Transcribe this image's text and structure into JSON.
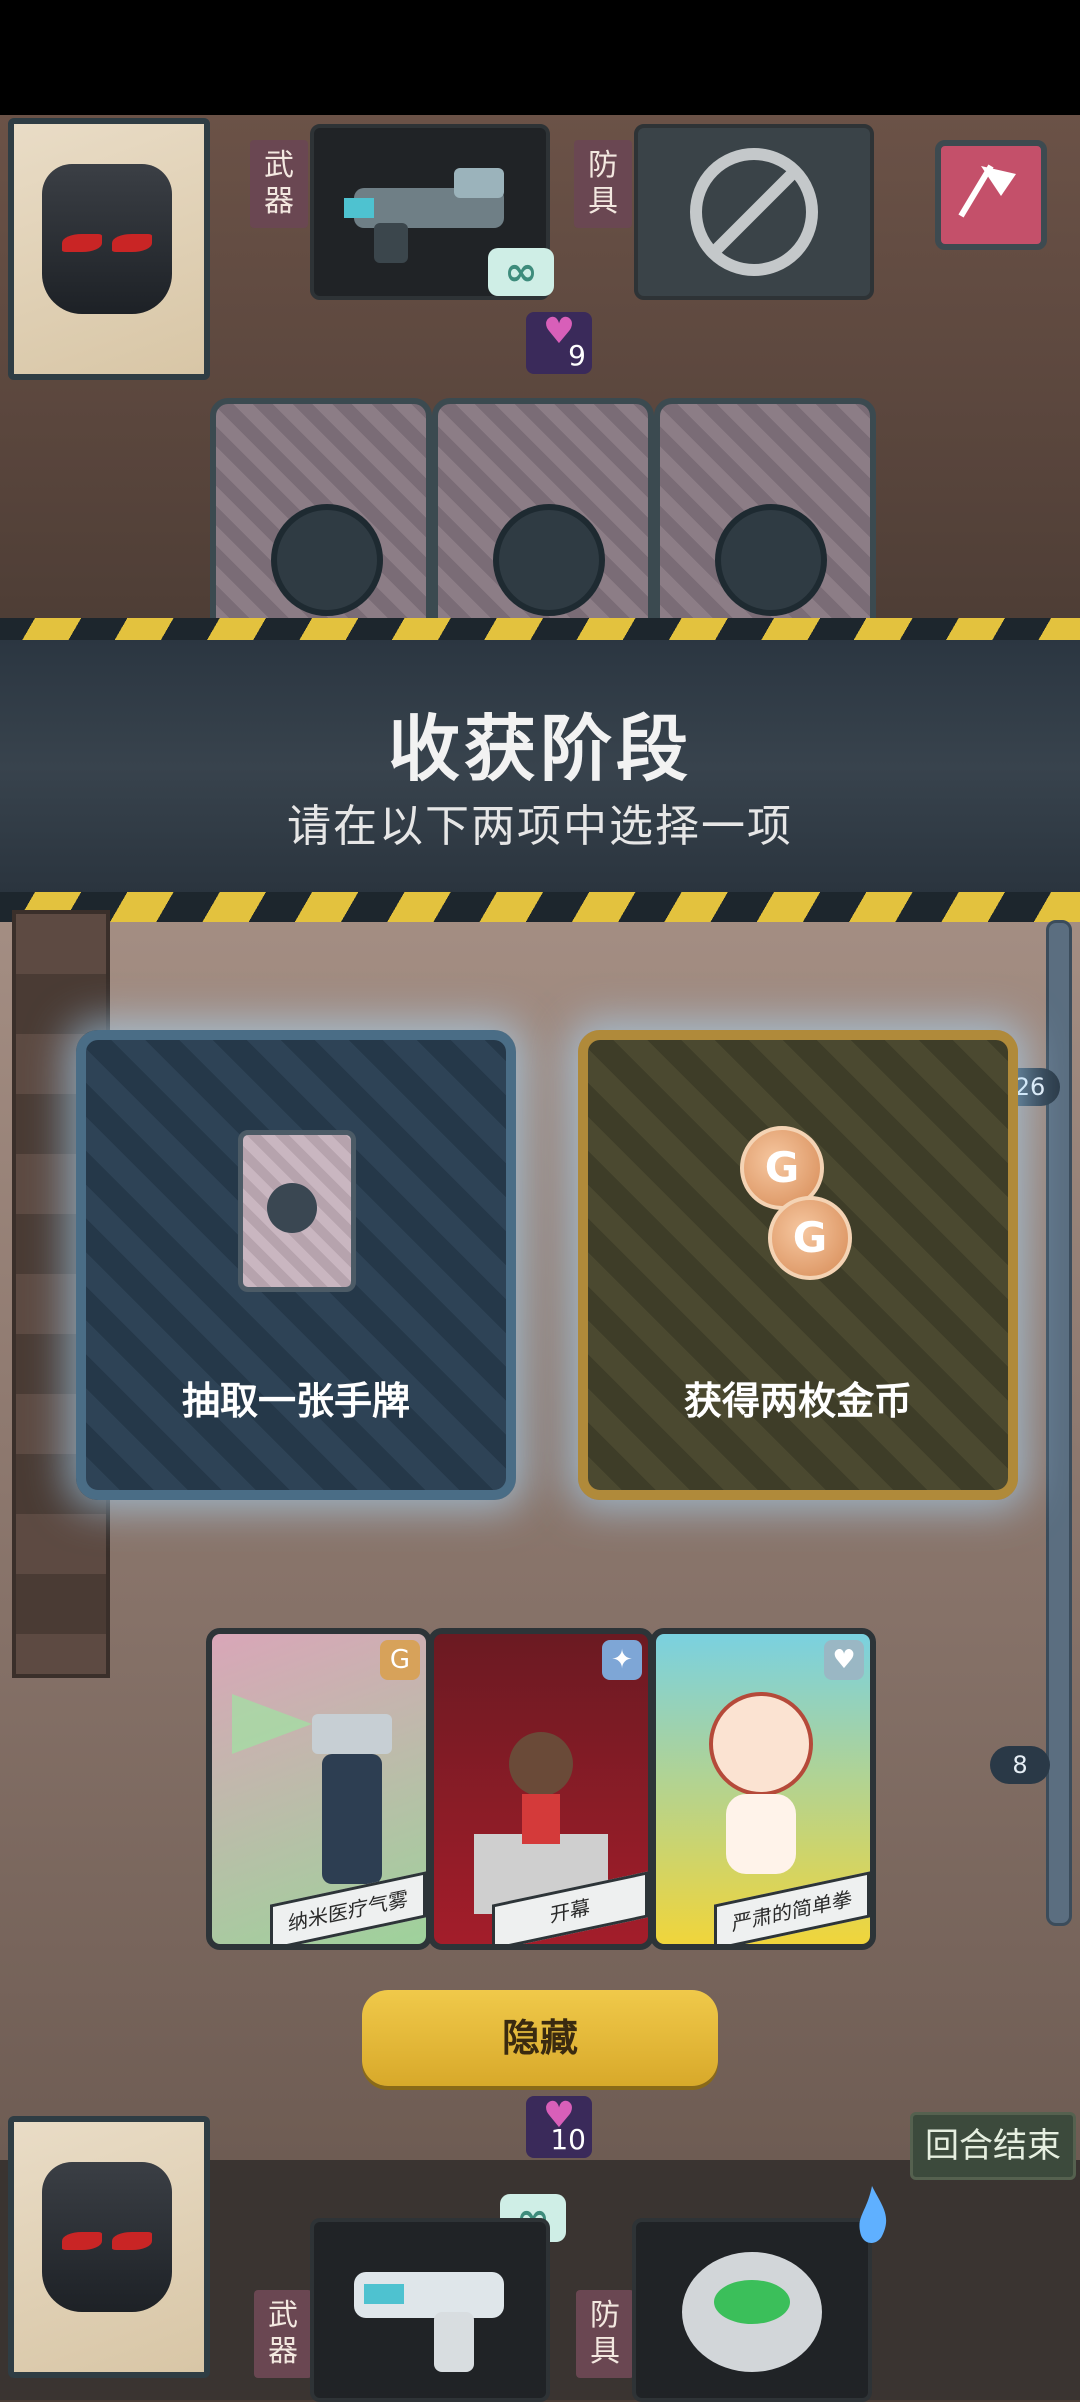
{
  "opponent": {
    "weapon_label": "武器",
    "armor_label": "防具",
    "infinity_badge": "∞",
    "heart_count": "9"
  },
  "phase": {
    "title": "收获阶段",
    "subtitle": "请在以下两项中选择一项"
  },
  "choices": [
    {
      "label": "抽取一张手牌"
    },
    {
      "label": "获得两枚金币"
    }
  ],
  "coin_symbol": "G",
  "hand_cards": [
    {
      "name": "纳米医疗气雾",
      "icon": "coin-icon"
    },
    {
      "name": "开幕",
      "icon": "sparkle-icon"
    },
    {
      "name": "严肃的简单拳",
      "icon": "heart-icon"
    }
  ],
  "track": {
    "top_value": "26",
    "bottom_value": "8"
  },
  "player": {
    "weapon_label": "武器",
    "armor_label": "防具",
    "infinity_badge": "∞",
    "heart_count": "10"
  },
  "buttons": {
    "hide": "隐藏",
    "end_turn": "回合结束"
  },
  "colors": {
    "accent_gold": "#d8a92a",
    "hazard_yellow": "#e3c23e",
    "banner_dark": "#2b3641"
  }
}
